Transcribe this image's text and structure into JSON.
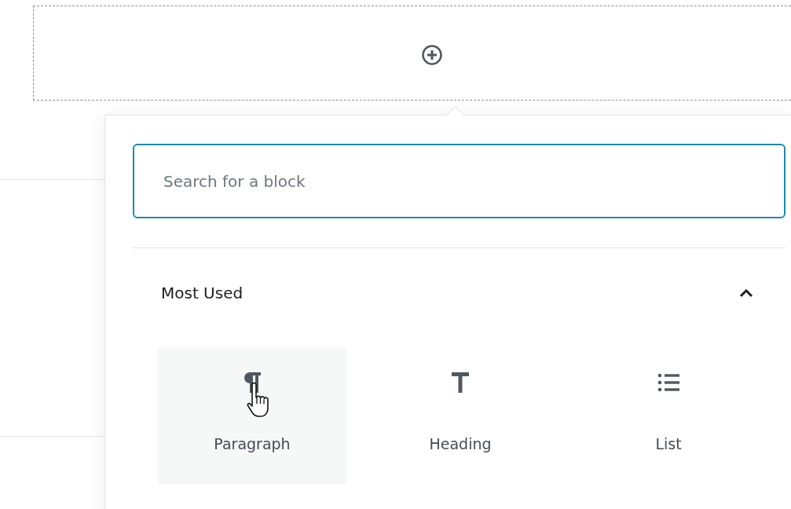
{
  "inserter": {
    "search": {
      "placeholder": "Search for a block"
    },
    "section": {
      "title": "Most Used",
      "expanded": true
    },
    "blocks": [
      {
        "label": "Paragraph",
        "kind": "paragraph",
        "hovered": true
      },
      {
        "label": "Heading",
        "kind": "heading",
        "hovered": false
      },
      {
        "label": "List",
        "kind": "list",
        "hovered": false
      }
    ]
  }
}
